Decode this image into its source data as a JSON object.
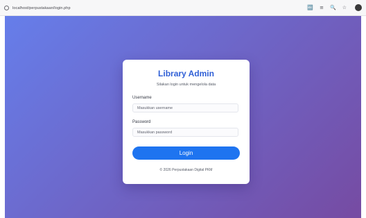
{
  "browser": {
    "url": "localhost/perpustakaan/login.php",
    "icons": [
      "translate-icon",
      "reader-mode-icon",
      "zoom-icon",
      "bookmark-star-icon",
      "profile-icon"
    ]
  },
  "colors": {
    "gradient_start": "#667eea",
    "gradient_end": "#764ba2",
    "title": "#2f5fd6",
    "button": "#1e74f0"
  },
  "login": {
    "title": "Library Admin",
    "subtitle": "Silakan login untuk mengelola data",
    "username_label": "Username",
    "username_placeholder": "Masukkan username",
    "username_value": "",
    "password_label": "Password",
    "password_placeholder": "Masukkan password",
    "password_value": "",
    "button_label": "Login",
    "footer": "© 2026 Perpustakaan Digital PKM"
  }
}
